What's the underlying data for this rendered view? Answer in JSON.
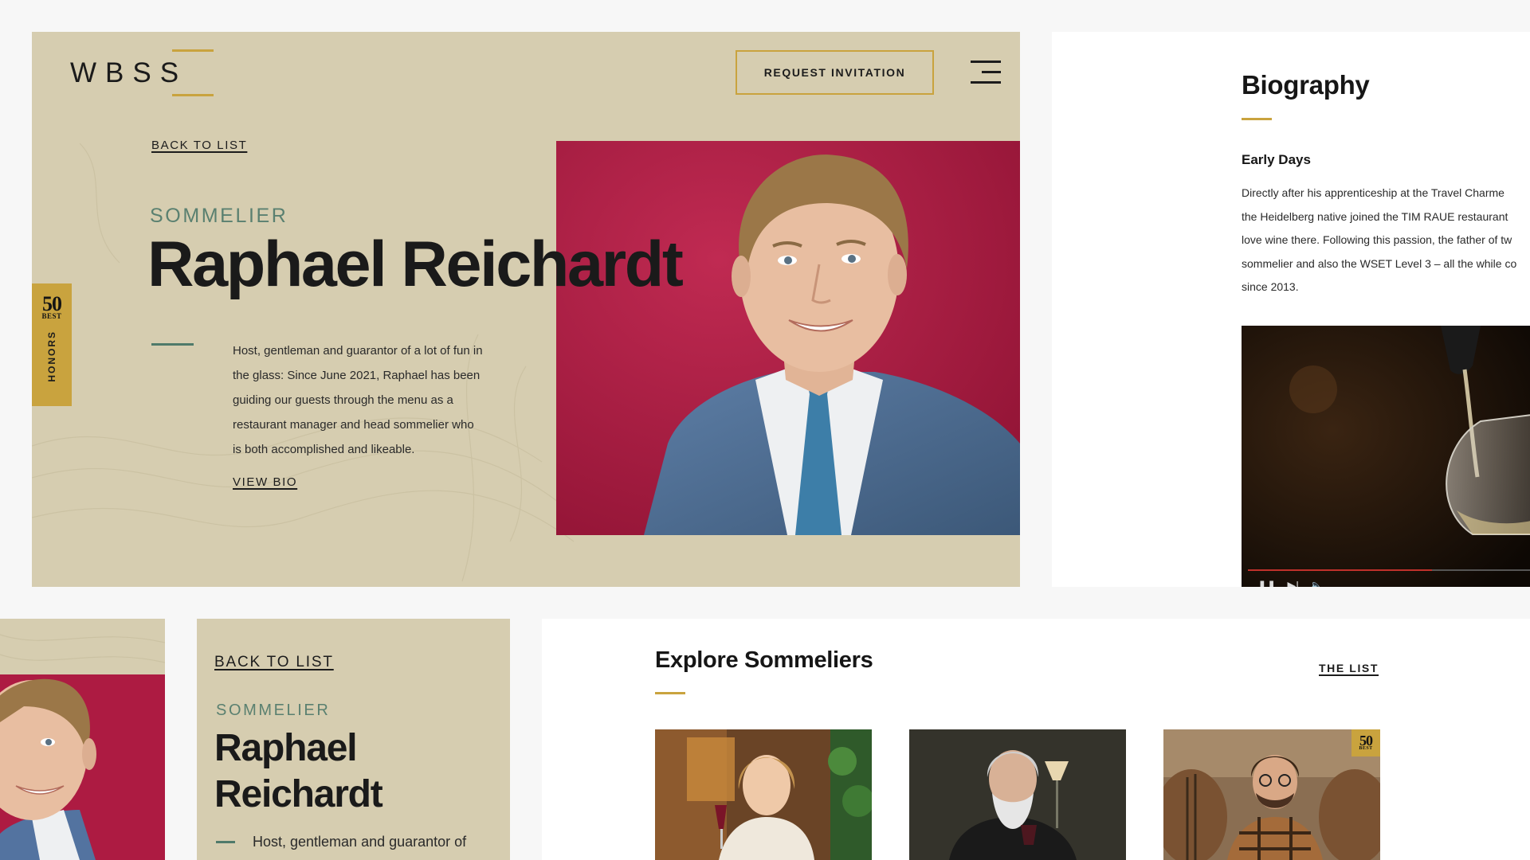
{
  "brand": {
    "logo_text": "WBSS"
  },
  "header": {
    "request_button": "REQUEST INVITATION"
  },
  "hero": {
    "back_link": "BACK TO LIST",
    "role": "SOMMELIER",
    "name": "Raphael Reichardt",
    "intro_lines": [
      "Host, gentleman and guarantor of a lot of fun in",
      "the glass: Since June 2021, Raphael has been",
      "guiding our guests through the menu as a",
      "restaurant manager and head sommelier who",
      "is both accomplished and likeable."
    ],
    "view_bio": "VIEW BIO"
  },
  "honors": {
    "label": "HONORS",
    "badge_number": "50",
    "badge_text": "BEST"
  },
  "biography": {
    "title": "Biography",
    "subtitle": "Early Days",
    "lines": [
      "Directly after his apprenticeship at the Travel Charme",
      "the Heidelberg native joined the TIM RAUE restaurant",
      "love wine there. Following this passion, the father of tw",
      "sommelier and also the WSET Level 3 – all the while co",
      "since 2013."
    ],
    "video_progress": 0.62
  },
  "mobile": {
    "back_link": "BACK TO LIST",
    "role": "SOMMELIER",
    "name_line1": "Raphael",
    "name_line2": "Reichardt",
    "intro_first_line": "Host, gentleman and guarantor of"
  },
  "explore": {
    "title": "Explore Sommeliers",
    "list_link": "THE LIST",
    "cards": [
      {
        "badge": false
      },
      {
        "badge": false
      },
      {
        "badge": true,
        "badge_number": "50",
        "badge_text": "BEST"
      }
    ]
  },
  "colors": {
    "beige": "#d6cdb0",
    "gold": "#c9a33e",
    "green": "#4f7a6a",
    "photo_bg": "#a8173e"
  }
}
